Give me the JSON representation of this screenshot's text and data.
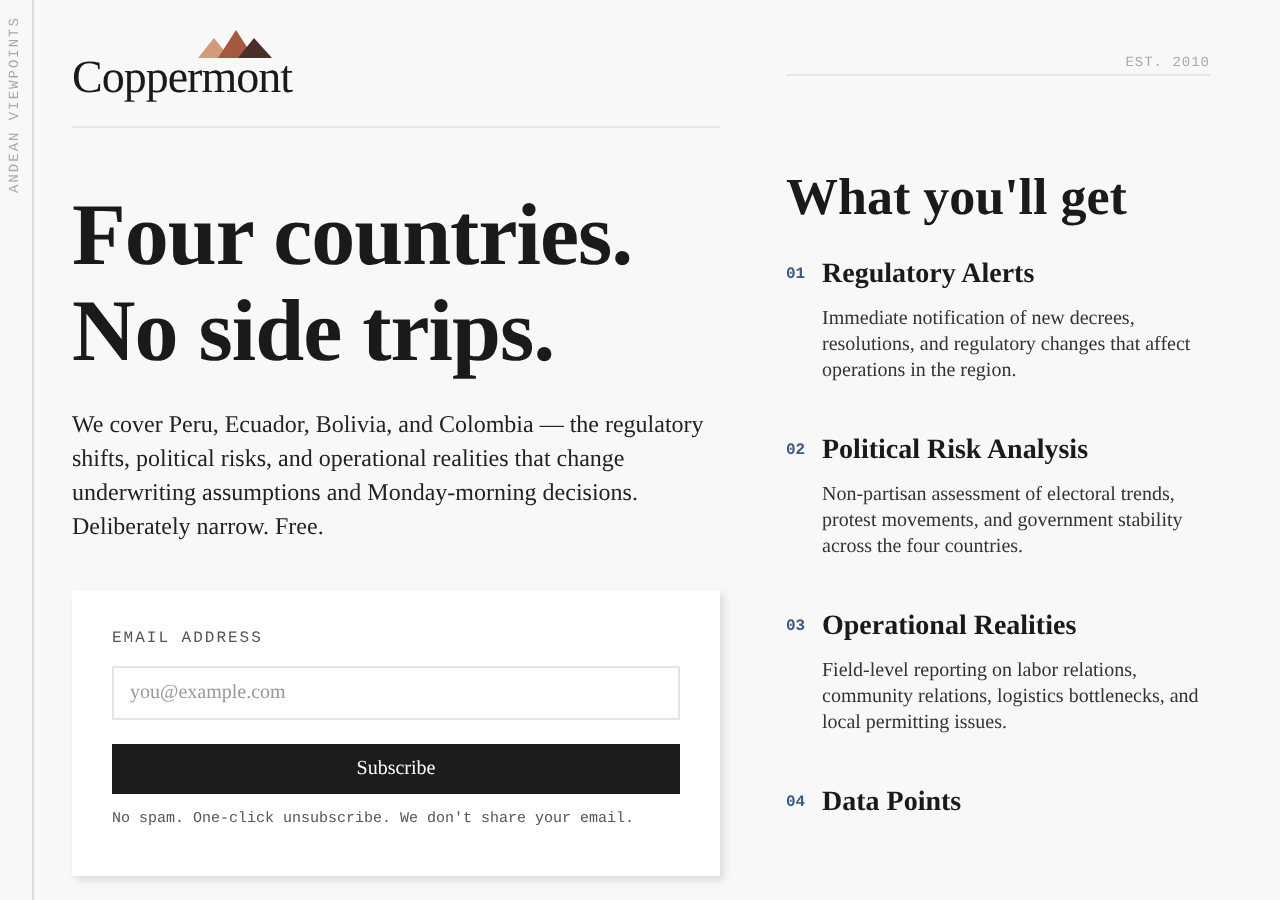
{
  "rail_label": "ANDEAN VIEWPOINTS",
  "brand": {
    "name": "Coppermont",
    "established": "EST. 2010"
  },
  "hero": {
    "headline": "Four countries. No side trips.",
    "intro": "We cover Peru, Ecuador, Bolivia, and Colombia — the regulatory shifts, political risks, and operational realities that change underwriting assumptions and Monday-morning decisions. Deliberately narrow. Free."
  },
  "signup": {
    "label": "EMAIL ADDRESS",
    "placeholder": "you@example.com",
    "button": "Subscribe",
    "note": "No spam. One-click unsubscribe. We don't share your email."
  },
  "benefits": {
    "heading": "What you'll get",
    "items": [
      {
        "number": "01",
        "title": "Regulatory Alerts",
        "text": "Immediate notification of new decrees, resolutions, and regulatory changes that affect operations in the region."
      },
      {
        "number": "02",
        "title": "Political Risk Analysis",
        "text": "Non-partisan assessment of electoral trends, protest movements, and government stability across the four countries."
      },
      {
        "number": "03",
        "title": "Operational Realities",
        "text": "Field-level reporting on labor relations, community relations, logistics bottlenecks, and local permitting issues."
      },
      {
        "number": "04",
        "title": "Data Points"
      }
    ]
  }
}
